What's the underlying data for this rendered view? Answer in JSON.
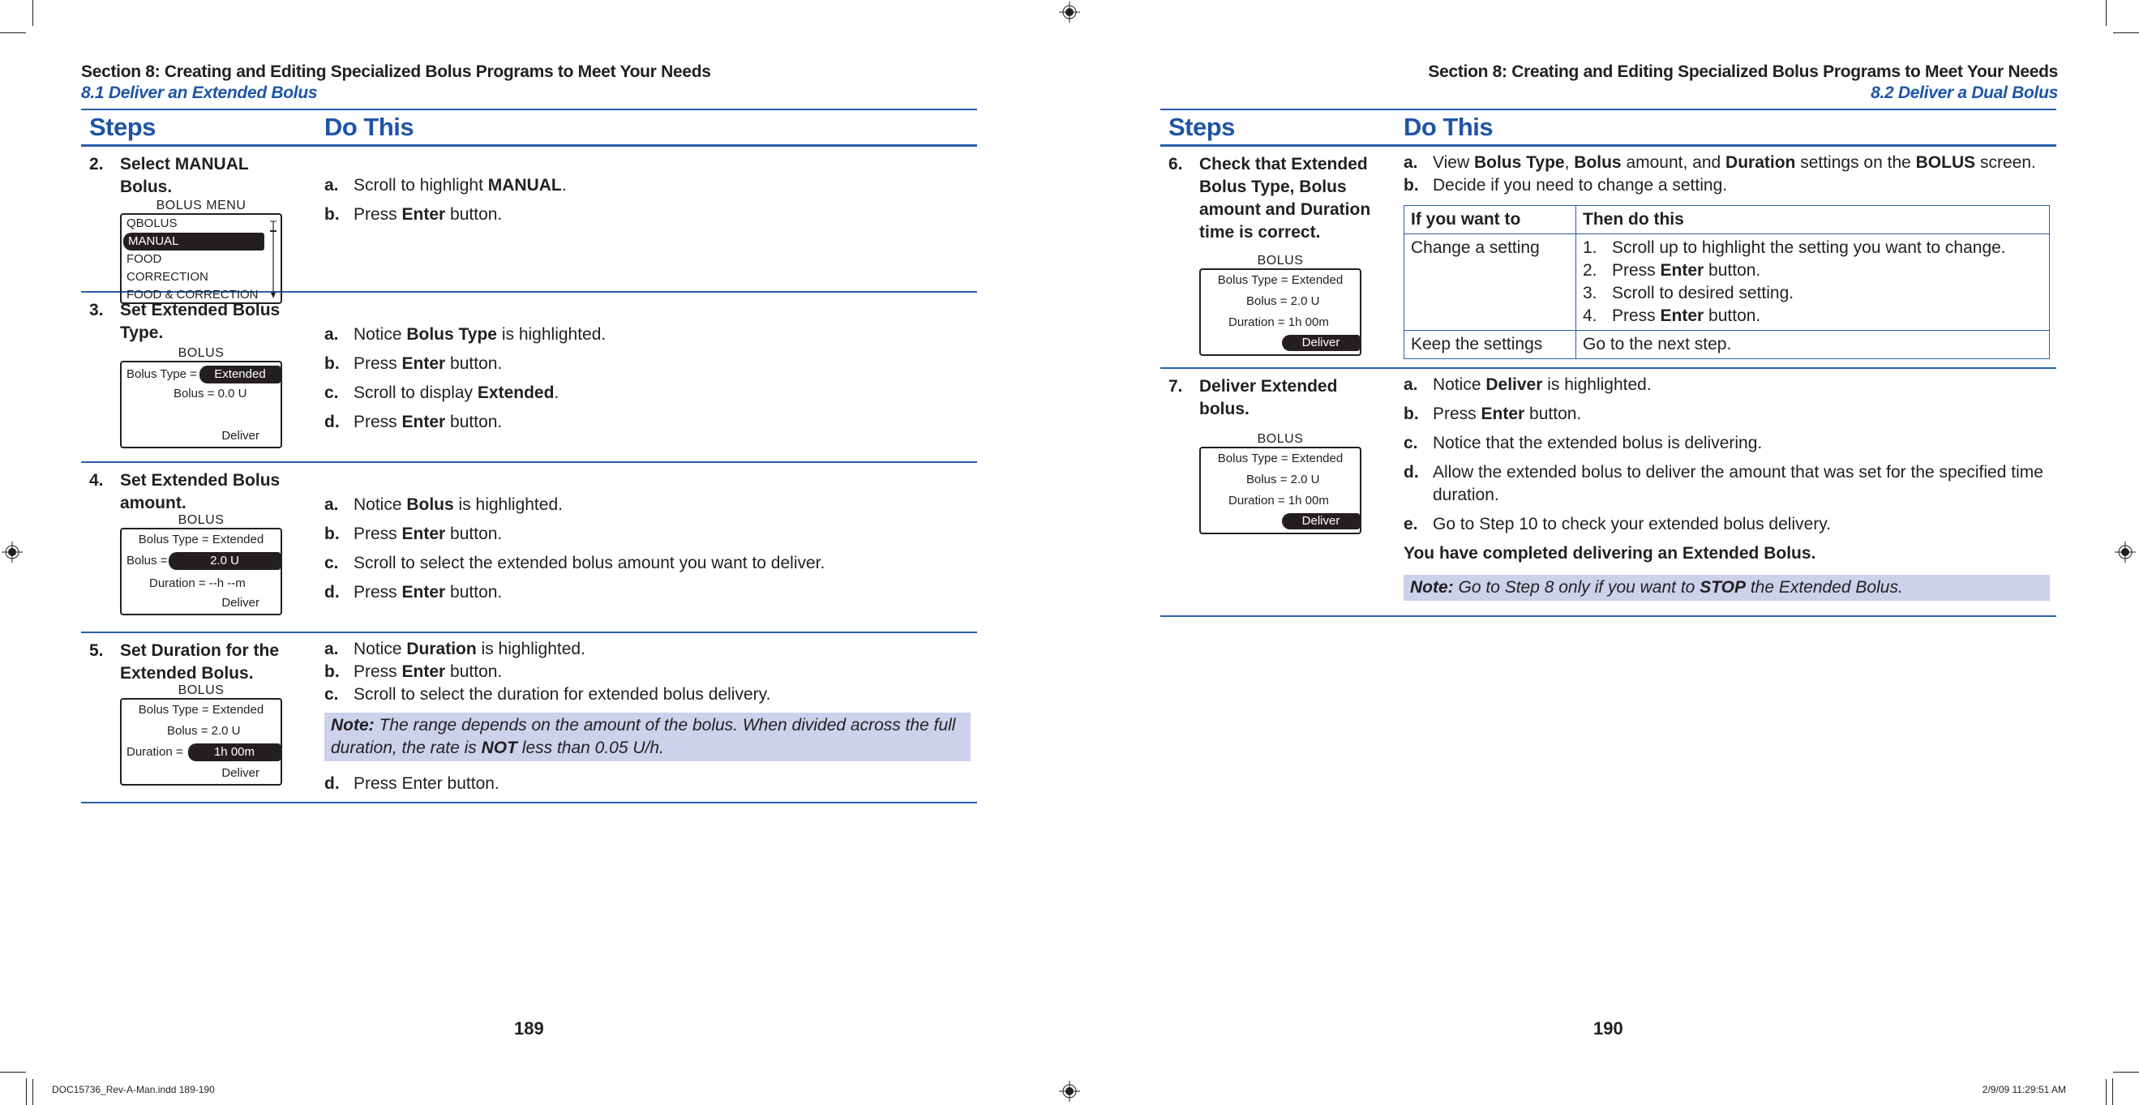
{
  "colors": {
    "accent_blue": "#1f55a6",
    "rule_blue": "#2a5ea8",
    "note_bg": "#ccd2ec",
    "text": "#231f20"
  },
  "left_page": {
    "section_title": "Section 8: Creating and Editing Specialized Bolus Programs to Meet Your Needs",
    "subsection": "8.1 Deliver an Extended Bolus",
    "col_steps": "Steps",
    "col_do": "Do This",
    "page_number": "189",
    "steps": [
      {
        "num": "2.",
        "title": "Select MANUAL Bolus.",
        "screen": {
          "title": "BOLUS MENU",
          "items": [
            "QBOLUS",
            "MANUAL",
            "FOOD",
            "CORRECTION",
            "FOOD & CORRECTION"
          ],
          "highlighted": "MANUAL"
        },
        "actions": [
          {
            "letter": "a.",
            "pre": "Scroll to highlight ",
            "bold": "MANUAL",
            "post": "."
          },
          {
            "letter": "b.",
            "pre": "Press ",
            "bold": "Enter",
            "post": " button."
          }
        ]
      },
      {
        "num": "3.",
        "title": "Set Extended Bolus Type.",
        "screen": {
          "title": "BOLUS",
          "line1_label": "Bolus Type =",
          "line1_value": "Extended",
          "line2": "Bolus = 0.0 U",
          "deliver": "Deliver"
        },
        "actions": [
          {
            "letter": "a.",
            "pre": "Notice ",
            "bold": "Bolus Type",
            "post": " is highlighted."
          },
          {
            "letter": "b.",
            "pre": "Press ",
            "bold": "Enter",
            "post": " button."
          },
          {
            "letter": "c.",
            "pre": "Scroll to display ",
            "bold": "Extended",
            "post": "."
          },
          {
            "letter": "d.",
            "pre": "Press ",
            "bold": "Enter",
            "post": " button."
          }
        ]
      },
      {
        "num": "4.",
        "title": "Set Extended Bolus amount.",
        "screen": {
          "title": "BOLUS",
          "line1": "Bolus Type = Extended",
          "line2_label": "Bolus =",
          "line2_value": "2.0 U",
          "line3": "Duration = --h --m",
          "deliver": "Deliver"
        },
        "actions": [
          {
            "letter": "a.",
            "pre": "Notice ",
            "bold": "Bolus",
            "post": " is highlighted."
          },
          {
            "letter": "b.",
            "pre": "Press ",
            "bold": "Enter",
            "post": " button."
          },
          {
            "letter": "c.",
            "pre": "Scroll to select the extended bolus amount you want to deliver.",
            "bold": "",
            "post": ""
          },
          {
            "letter": "d.",
            "pre": "Press ",
            "bold": "Enter",
            "post": " button."
          }
        ]
      },
      {
        "num": "5.",
        "title": "Set Duration for the Extended Bolus.",
        "screen": {
          "title": "BOLUS",
          "line1": "Bolus Type = Extended",
          "line2": "Bolus = 2.0 U",
          "line3_label": "Duration =",
          "line3_value": "1h 00m",
          "deliver": "Deliver"
        },
        "actions": [
          {
            "letter": "a.",
            "pre": "Notice ",
            "bold": "Duration",
            "post": " is highlighted."
          },
          {
            "letter": "b.",
            "pre": "Press ",
            "bold": "Enter",
            "post": " button."
          },
          {
            "letter": "c.",
            "pre": "Scroll to select the duration for extended bolus delivery.",
            "bold": "",
            "post": ""
          }
        ],
        "note": {
          "label": "Note:",
          "pre": " The range depends on the amount of the bolus. When divided across the full duration, the rate is ",
          "bold": "NOT",
          "post": " less than 0.05 U/h."
        },
        "final_action": {
          "letter": "d.",
          "text": "Press Enter button."
        }
      }
    ]
  },
  "right_page": {
    "section_title": "Section 8: Creating and Editing Specialized Bolus Programs to Meet Your Needs",
    "subsection": "8.2 Deliver a Dual Bolus",
    "col_steps": "Steps",
    "col_do": "Do This",
    "page_number": "190",
    "steps": [
      {
        "num": "6.",
        "title": "Check that Extended Bolus Type, Bolus amount and Duration time is correct.",
        "screen": {
          "title": "BOLUS",
          "line1": "Bolus Type = Extended",
          "line2": "Bolus = 2.0 U",
          "line3": "Duration = 1h 00m",
          "deliver": "Deliver"
        },
        "action_a": {
          "letter": "a.",
          "t1": "View ",
          "b1": "Bolus Type",
          "t2": ", ",
          "b2": "Bolus",
          "t3": " amount, and ",
          "b3": "Duration",
          "t4": " settings on the ",
          "b4": "BOLUS",
          "t5": " screen."
        },
        "action_b": {
          "letter": "b.",
          "text": "Decide if you need to change a setting."
        },
        "decision_table": {
          "headers": [
            "If you want to",
            "Then do this"
          ],
          "rows": [
            {
              "condition": "Change a setting",
              "steps": [
                {
                  "n": "1.",
                  "pre": "Scroll up to highlight the setting you want to change.",
                  "bold": "",
                  "post": ""
                },
                {
                  "n": "2.",
                  "pre": "Press ",
                  "bold": "Enter",
                  "post": " button."
                },
                {
                  "n": "3.",
                  "pre": "Scroll to desired setting.",
                  "bold": "",
                  "post": ""
                },
                {
                  "n": "4.",
                  "pre": "Press ",
                  "bold": "Enter",
                  "post": " button."
                }
              ]
            },
            {
              "condition": "Keep the settings",
              "action": "Go to the next step."
            }
          ]
        }
      },
      {
        "num": "7.",
        "title": "Deliver Extended bolus.",
        "screen": {
          "title": "BOLUS",
          "line1": "Bolus Type = Extended",
          "line2": "Bolus = 2.0 U",
          "line3": "Duration = 1h 00m",
          "deliver": "Deliver"
        },
        "actions": [
          {
            "letter": "a.",
            "pre": "Notice ",
            "bold": "Deliver",
            "post": " is highlighted."
          },
          {
            "letter": "b.",
            "pre": "Press ",
            "bold": "Enter",
            "post": " button."
          },
          {
            "letter": "c.",
            "pre": "Notice that the extended bolus is delivering.",
            "bold": "",
            "post": ""
          },
          {
            "letter": "d.",
            "pre": "Allow the extended bolus to deliver the amount that was set for the specified time duration.",
            "bold": "",
            "post": ""
          },
          {
            "letter": "e.",
            "pre": "Go to Step 10 to check your extended bolus delivery.",
            "bold": "",
            "post": ""
          }
        ],
        "completion": "You have completed delivering an Extended Bolus.",
        "note": {
          "label": "Note:",
          "pre": " Go to Step 8 only if you want to ",
          "bold": "STOP",
          "post": " the Extended Bolus."
        }
      }
    ]
  },
  "slug": {
    "file": "DOC15736_Rev-A-Man.indd   189-190",
    "timestamp": "2/9/09   11:29:51 AM"
  }
}
